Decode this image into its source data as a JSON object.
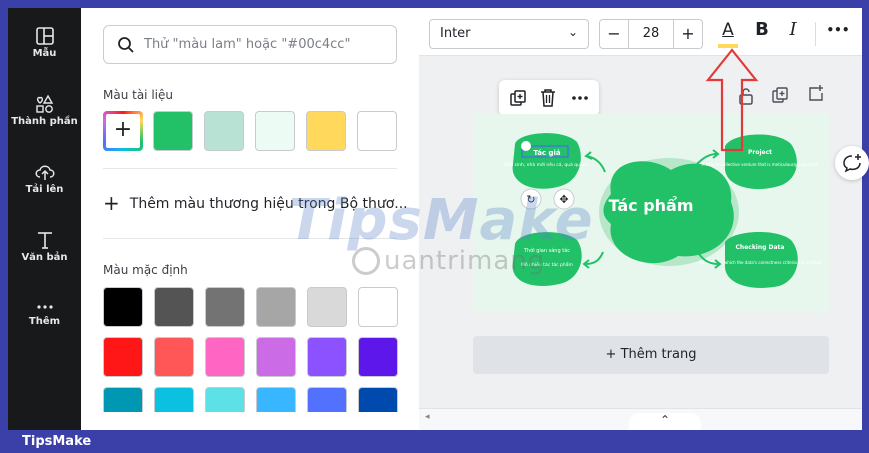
{
  "sidebar": {
    "items": [
      {
        "label": "Mẫu",
        "icon": "template-icon"
      },
      {
        "label": "Thành phần",
        "icon": "elements-icon"
      },
      {
        "label": "Tải lên",
        "icon": "upload-icon"
      },
      {
        "label": "Văn bản",
        "icon": "text-icon"
      },
      {
        "label": "Thêm",
        "icon": "more-icon"
      }
    ]
  },
  "panel": {
    "search_placeholder": "Thử \"màu lam\" hoặc \"#00c4cc\"",
    "document_colors_title": "Màu tài liệu",
    "document_colors": [
      "#22c168",
      "#b7e2d4",
      "#ecfcf4",
      "#ffd85c",
      "#ffffff"
    ],
    "add_brand_label": "Thêm màu thương hiệu trong Bộ thươ...",
    "default_colors_title": "Màu mặc định",
    "default_colors": [
      [
        "#000000",
        "#545454",
        "#737373",
        "#a6a6a6",
        "#d9d9d9",
        "#ffffff"
      ],
      [
        "#ff1616",
        "#ff5757",
        "#ff66c4",
        "#cb6ce6",
        "#8c52ff",
        "#5e17eb"
      ],
      [
        "#0097b2",
        "#0cc0df",
        "#5ce1e6",
        "#38b6ff",
        "#5271ff",
        "#004aad"
      ]
    ]
  },
  "toolbar": {
    "font_name": "Inter",
    "font_size": "28",
    "minus_label": "−",
    "plus_label": "+",
    "text_color_label": "A",
    "bold_label": "B",
    "italic_label": "I",
    "more_label": "•••"
  },
  "canvas": {
    "center_title": "Tác phẩm",
    "nodes": [
      {
        "title": "Tác giả",
        "body": "Nhà sinh, nhà mới nêu cá, quá quản..."
      },
      {
        "title": "Project",
        "body": "A safe or collective venture that is meticulously organized"
      },
      {
        "title": "Thời gian sáng tác",
        "body": "Mô nhiều tác tác phẩm"
      },
      {
        "title": "Checking Data",
        "body": "An action in which the data's correctness criteria are verified"
      }
    ],
    "add_page_label": "+ Thêm trang"
  },
  "footer": {
    "brand": "TipsMake"
  },
  "watermark": {
    "main": "TipsMake",
    "sub": "uantrimang"
  },
  "colors": {
    "brand_bar": "#3b3fa8",
    "node_green": "#22c168",
    "highlight_red": "#e23a3a"
  }
}
